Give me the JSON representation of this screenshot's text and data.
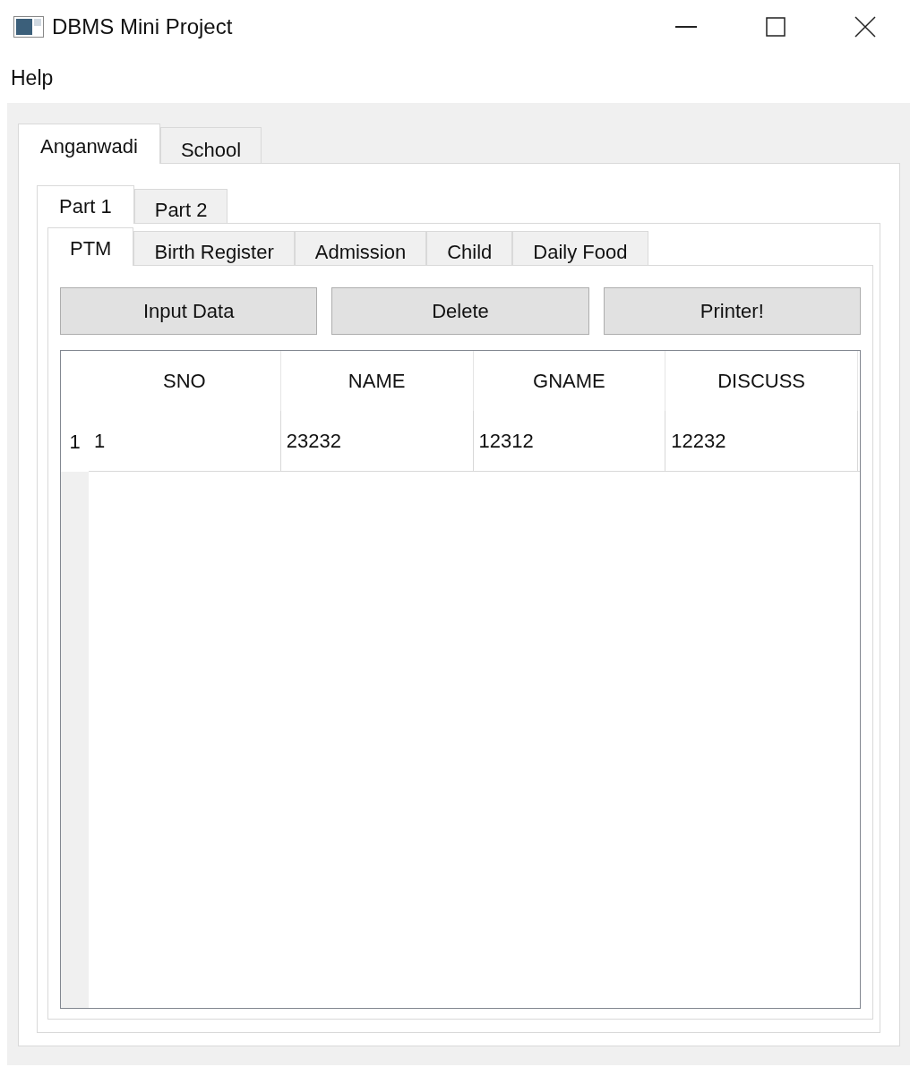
{
  "window": {
    "title": "DBMS Mini Project"
  },
  "menu": [
    "Help"
  ],
  "tabs": [
    {
      "label": "Anganwadi",
      "selected": true
    },
    {
      "label": "School",
      "selected": false
    }
  ],
  "subtabs": [
    {
      "label": "Part 1",
      "selected": true
    },
    {
      "label": "Part 2",
      "selected": false
    }
  ],
  "sections": [
    {
      "label": "PTM",
      "selected": true
    },
    {
      "label": "Birth Register",
      "selected": false
    },
    {
      "label": "Admission",
      "selected": false
    },
    {
      "label": "Child",
      "selected": false
    },
    {
      "label": "Daily Food",
      "selected": false
    }
  ],
  "buttons": [
    "Input Data",
    "Delete",
    "Printer!"
  ],
  "table": {
    "columns": [
      "SNO",
      "NAME",
      "GNAME",
      "DISCUSS"
    ],
    "rows": [
      {
        "header": "1",
        "cells": [
          "1",
          "23232",
          "12312",
          "12232"
        ]
      }
    ]
  }
}
